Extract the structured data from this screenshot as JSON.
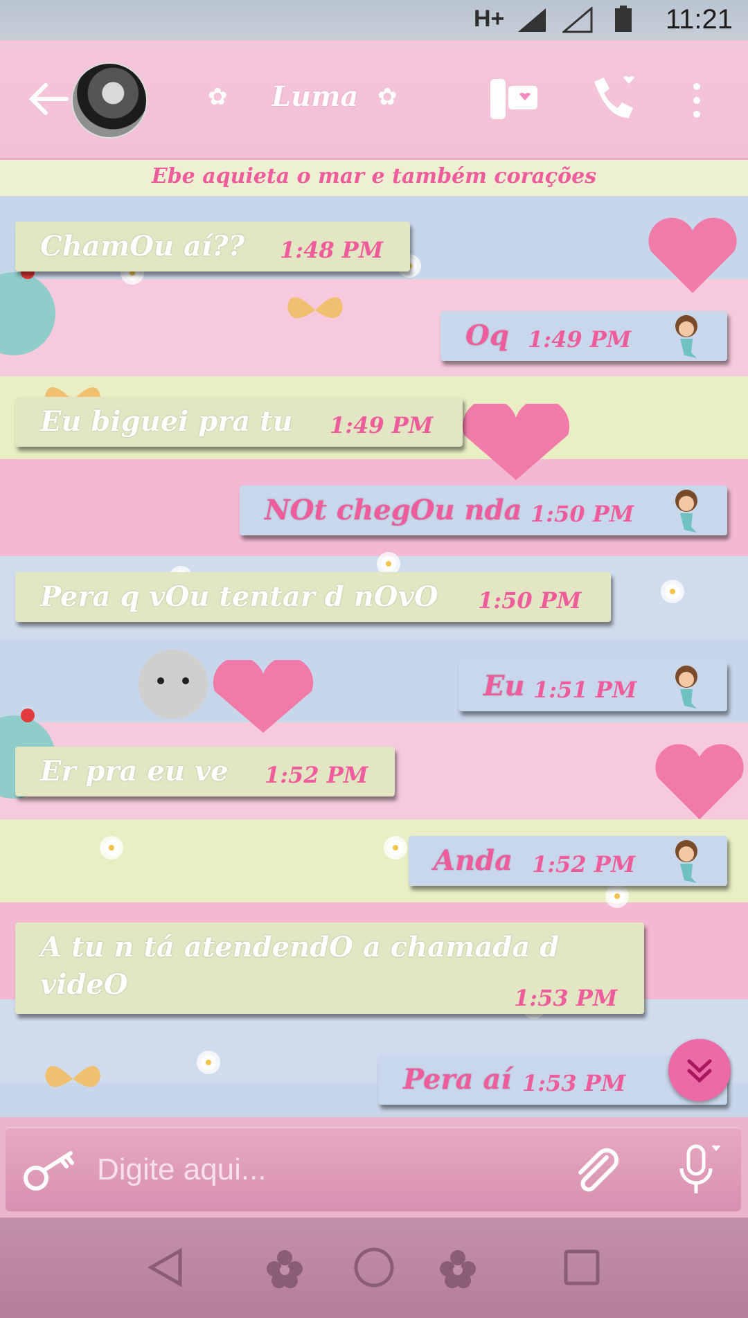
{
  "status_bar": {
    "network": "H+",
    "time": "11:21"
  },
  "header": {
    "contact_name": "Luma",
    "subtitle": "Ebe aquieta o mar e também corações"
  },
  "input": {
    "placeholder": "Digite aqui..."
  },
  "messages": [
    {
      "dir": "in",
      "text": "ChamOu aí??",
      "time": "1:48 PM"
    },
    {
      "dir": "out",
      "text": "Oq",
      "time": "1:49 PM"
    },
    {
      "dir": "in",
      "text": "Eu biguei pra tu",
      "time": "1:49 PM"
    },
    {
      "dir": "out",
      "text": "NOt chegOu nda",
      "time": "1:50 PM"
    },
    {
      "dir": "in",
      "text": "Pera q vOu tentar d nOvO",
      "time": "1:50 PM"
    },
    {
      "dir": "out",
      "text": "Eu",
      "time": "1:51 PM"
    },
    {
      "dir": "in",
      "text": "Er pra eu ve",
      "time": "1:52 PM"
    },
    {
      "dir": "out",
      "text": "Anda",
      "time": "1:52 PM"
    },
    {
      "dir": "in",
      "text": "A tu n tá atendendO a chamada d",
      "text2": "videO",
      "time": "1:53 PM"
    },
    {
      "dir": "out",
      "text": "Pera aí",
      "time": "1:53 PM"
    }
  ]
}
